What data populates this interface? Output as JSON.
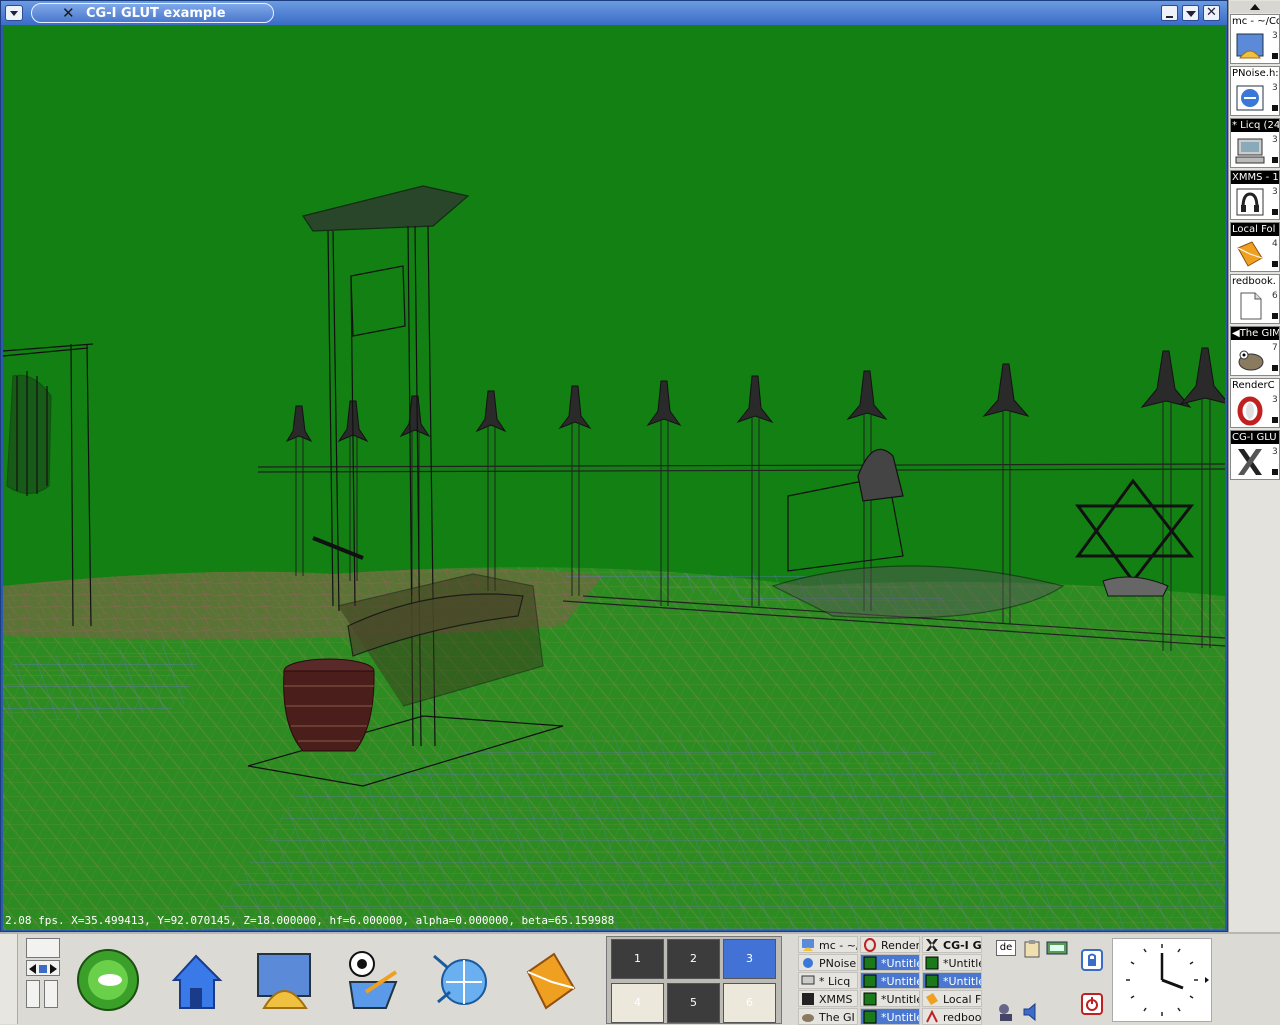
{
  "window": {
    "title": "CG-I GLUT example",
    "status": "2.08 fps.  X=35.499413, Y=92.070145, Z=18.000000, hf=6.000000, alpha=0.000000, beta=65.159988",
    "close_glyph": "✕"
  },
  "window_list": [
    {
      "title": "mc - ~/Co",
      "num": "3",
      "icon": "konqueror-icon"
    },
    {
      "title": "PNoise.h:",
      "num": "3",
      "icon": "kdevelop-icon"
    },
    {
      "title": "* Licq (24",
      "num": "3",
      "icon": "computer-icon"
    },
    {
      "title": "XMMS - 1",
      "num": "3",
      "icon": "xmms-icon"
    },
    {
      "title": "Local Fol",
      "num": "4",
      "icon": "kmail-icon"
    },
    {
      "title": "redbook.",
      "num": "6",
      "icon": "document-icon"
    },
    {
      "title": "◀The GIM",
      "num": "7",
      "icon": "gimp-icon"
    },
    {
      "title": "RenderC",
      "num": "3",
      "icon": "render-icon"
    },
    {
      "title": "CG-I GLU",
      "num": "3",
      "icon": "x-icon"
    }
  ],
  "pager": {
    "desktops": [
      "1",
      "2",
      "3",
      "4",
      "5",
      "6"
    ],
    "active": "3"
  },
  "taskbar": {
    "tasks": [
      {
        "label": "mc - ~/",
        "icon": "konqueror-icon",
        "state": "normal"
      },
      {
        "label": "Render",
        "icon": "render-icon",
        "state": "normal"
      },
      {
        "label": "CG-I G",
        "icon": "x-icon",
        "state": "bold"
      },
      {
        "label": "PNoise",
        "icon": "kdevelop-icon",
        "state": "normal"
      },
      {
        "label": "*Untitle",
        "icon": "gimp-image-icon",
        "state": "sel"
      },
      {
        "label": "*Untitle",
        "icon": "gimp-image-icon",
        "state": "normal"
      },
      {
        "label": "* Licq",
        "icon": "computer-icon",
        "state": "normal"
      },
      {
        "label": "*Untitle",
        "icon": "gimp-image-icon",
        "state": "sel"
      },
      {
        "label": "*Untitle",
        "icon": "gimp-image-icon",
        "state": "sel"
      },
      {
        "label": "XMMS",
        "icon": "xmms-icon",
        "state": "normal"
      },
      {
        "label": "*Untitle",
        "icon": "gimp-image-icon",
        "state": "normal"
      },
      {
        "label": "Local F",
        "icon": "kmail-icon",
        "state": "normal"
      },
      {
        "label": "The GI",
        "icon": "gimp-icon",
        "state": "normal"
      },
      {
        "label": "*Untitle",
        "icon": "gimp-image-icon",
        "state": "sel"
      },
      {
        "label": "redboo",
        "icon": "pdf-icon",
        "state": "normal"
      }
    ]
  },
  "tray": {
    "keyboard_layout": "de"
  },
  "launchers": [
    "suse-icon",
    "home-icon",
    "konqueror-icon",
    "kdevelop-icon",
    "browser-icon",
    "kmail-icon"
  ]
}
